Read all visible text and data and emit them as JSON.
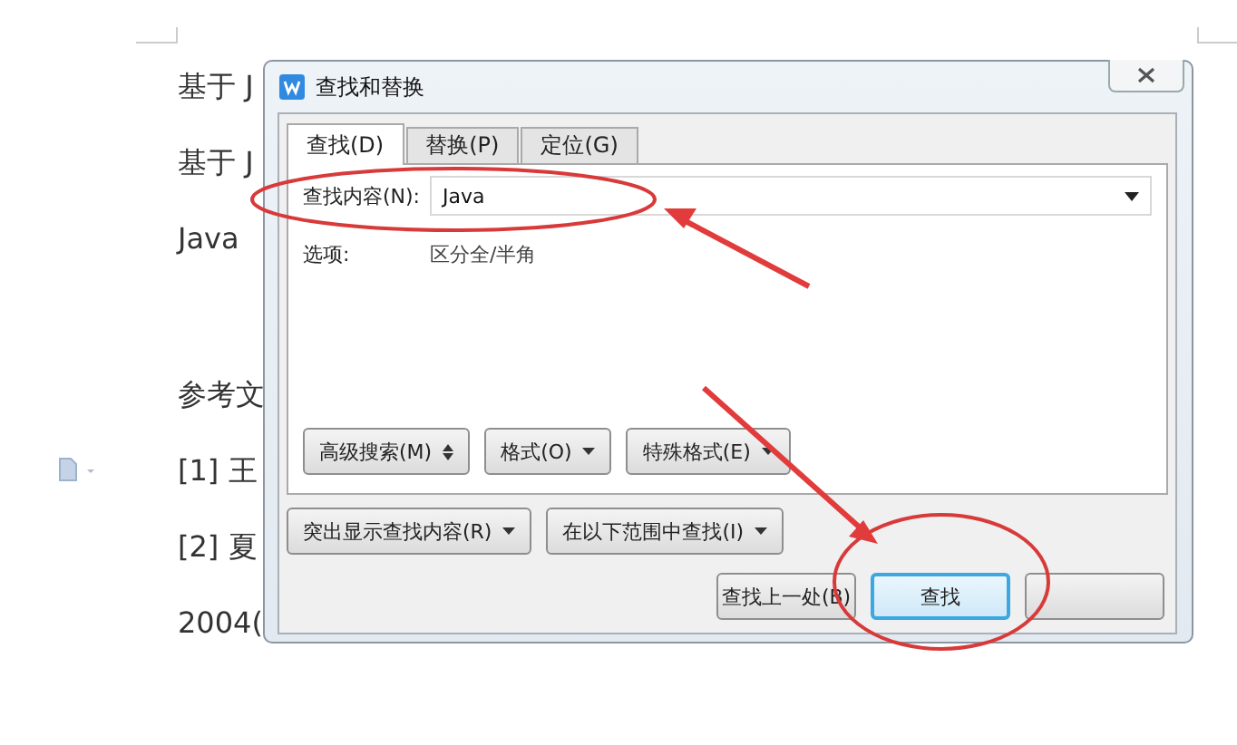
{
  "document": {
    "sections": [
      {
        "lines": [
          "基于 J",
          "基于 J",
          "Java"
        ]
      },
      {
        "lines": [
          "参考文",
          "[1] 王",
          "[2] 夏",
          "2004("
        ]
      }
    ]
  },
  "dialog": {
    "title": "查找和替换",
    "tabs": [
      {
        "label": "查找(D)",
        "selected": true
      },
      {
        "label": "替换(P)",
        "selected": false
      },
      {
        "label": "定位(G)",
        "selected": false
      }
    ],
    "find": {
      "label": "查找内容(N):",
      "value": "Java"
    },
    "options": {
      "label": "选项:",
      "value": "区分全/半角"
    },
    "panel_buttons": [
      {
        "label": "高级搜索(M)",
        "kind": "expand"
      },
      {
        "label": "格式(O)",
        "kind": "menu"
      },
      {
        "label": "特殊格式(E)",
        "kind": "menu"
      }
    ],
    "lower_buttons": [
      {
        "label": "突出显示查找内容(R)",
        "kind": "menu"
      },
      {
        "label": "在以下范围中查找(I)",
        "kind": "menu"
      }
    ],
    "action_buttons": [
      {
        "label": "查找上一处(B)",
        "focused": false
      },
      {
        "label": "查找",
        "focused": true
      },
      {
        "focused": false
      }
    ]
  }
}
